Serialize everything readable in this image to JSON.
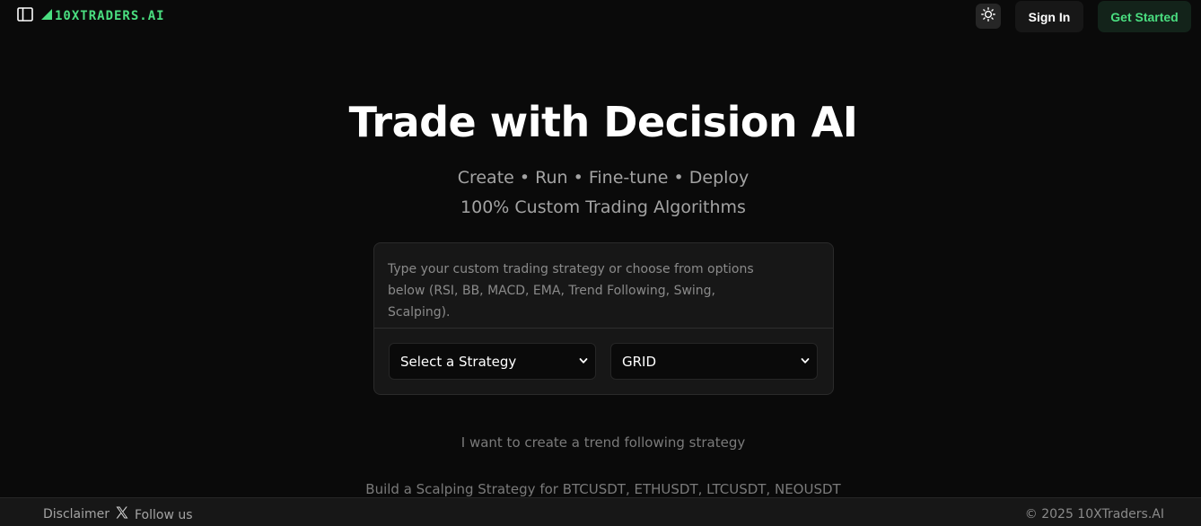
{
  "header": {
    "logo_text": "10XTRADERS.AI",
    "sidebar_toggle_icon": "sidebar-icon",
    "theme_toggle_icon": "sun-icon",
    "sign_in_label": "Sign In",
    "get_started_label": "Get Started",
    "accent_color": "#4ade80"
  },
  "hero": {
    "title": "Trade with Decision AI",
    "subtitle_line1": "Create • Run • Fine-tune • Deploy",
    "subtitle_line2": "100% Custom Trading Algorithms"
  },
  "prompt": {
    "placeholder": "Type your custom trading strategy or choose from options below (RSI, BB, MACD, EMA, Trend Following, Swing, Scalping).",
    "value": ""
  },
  "selects": {
    "strategy": {
      "selected": "Select a Strategy",
      "icon": "chevron-down-icon"
    },
    "type": {
      "selected": "GRID",
      "icon": "chevron-down-icon"
    }
  },
  "suggestions": [
    "I want to create a trend following strategy",
    "Build a Scalping Strategy for BTCUSDT, ETHUSDT, LTCUSDT, NEOUSDT"
  ],
  "footer": {
    "disclaimer": "Disclaimer",
    "follow_label": "Follow us",
    "follow_icon": "x-logo-icon",
    "copyright": "© 2025 10XTraders.AI"
  }
}
